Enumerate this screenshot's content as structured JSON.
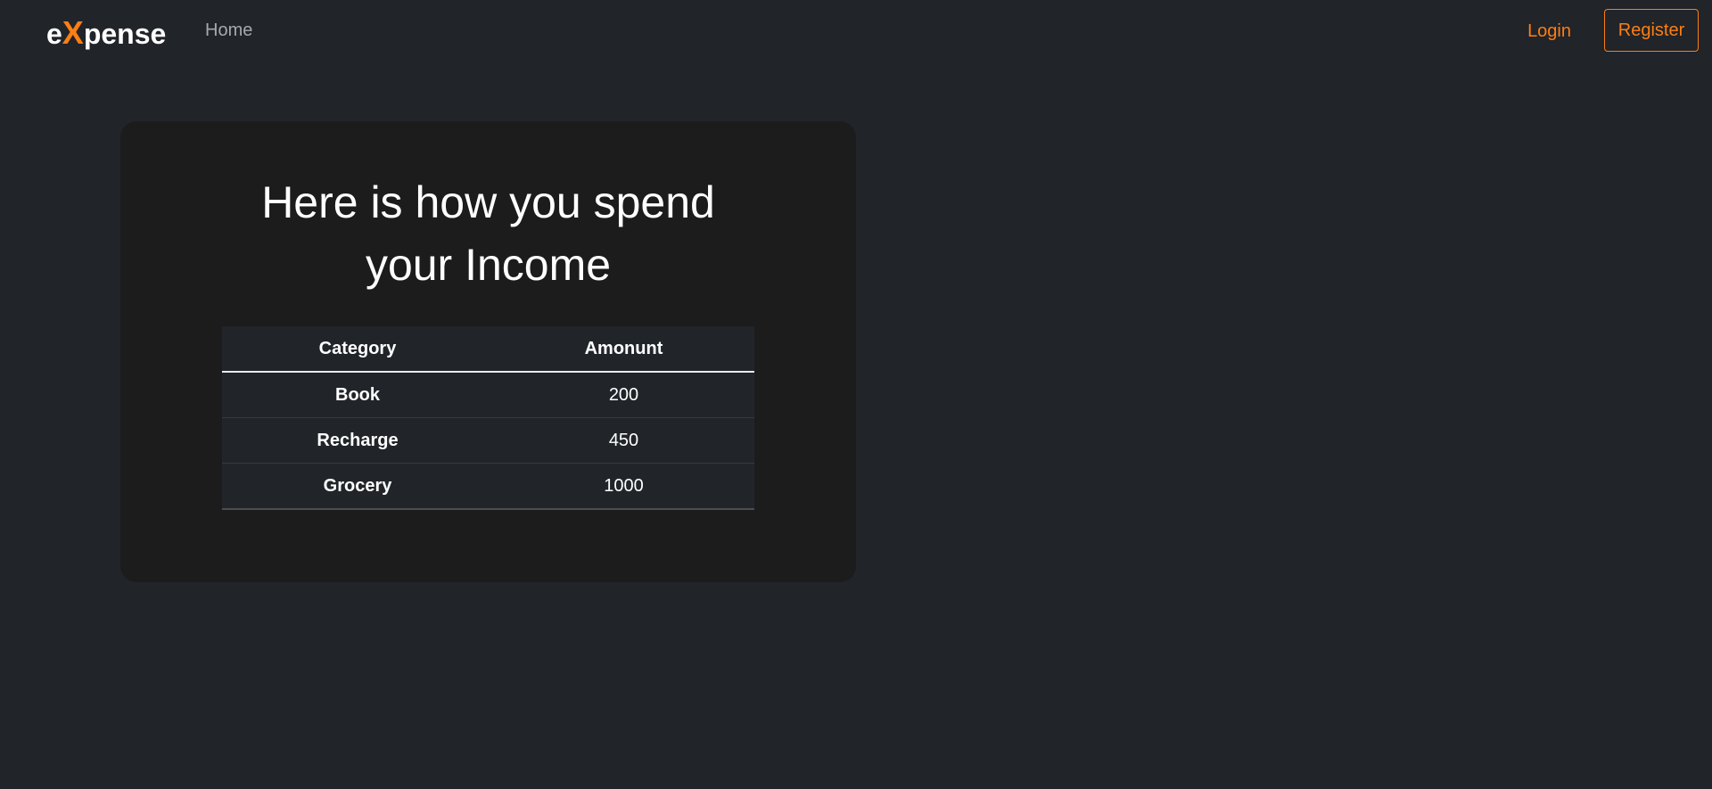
{
  "navbar": {
    "brand": {
      "prefix": "e",
      "highlight": "X",
      "suffix": "pense"
    },
    "home_label": "Home",
    "login_label": "Login",
    "register_label": "Register"
  },
  "card": {
    "title_line1": "Here is how you spend",
    "title_line2": "your Income"
  },
  "table": {
    "headers": {
      "category": "Category",
      "amount": "Amonunt"
    },
    "rows": [
      {
        "category": "Book",
        "amount": "200"
      },
      {
        "category": "Recharge",
        "amount": "450"
      },
      {
        "category": "Grocery",
        "amount": "1000"
      }
    ]
  },
  "colors": {
    "background": "#212429",
    "card": "#1c1c1c",
    "accent": "#fd7e14",
    "table": "#212529"
  }
}
